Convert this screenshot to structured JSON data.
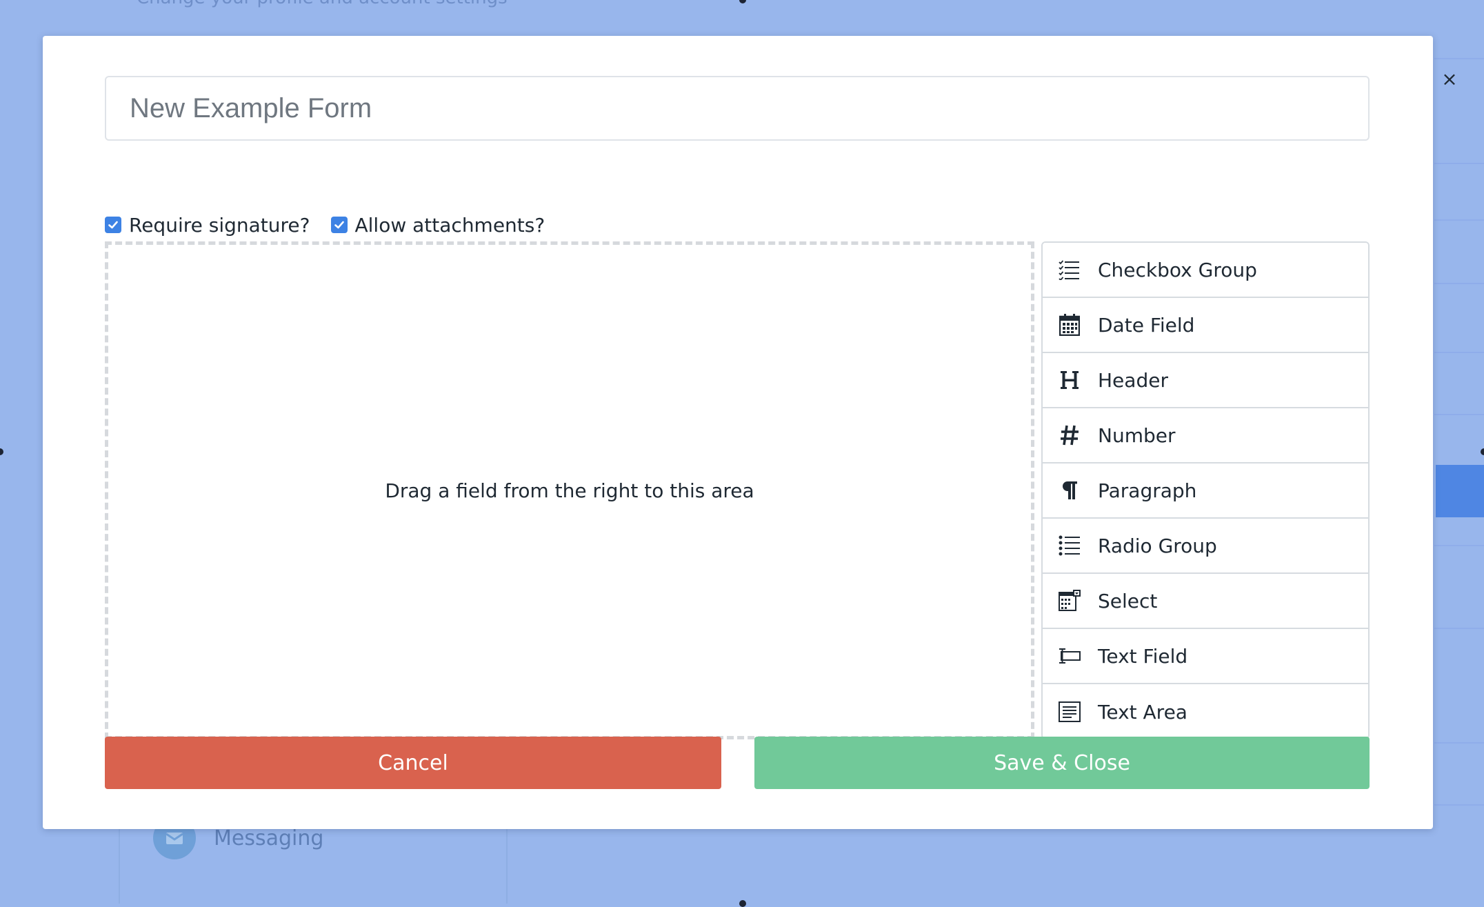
{
  "background": {
    "subtitle": "Change your profile and account settings",
    "sidebar_item_messaging": "Messaging"
  },
  "modal": {
    "form_title_placeholder": "New Example Form",
    "options": [
      {
        "label": "Require signature?",
        "checked": true
      },
      {
        "label": "Allow attachments?",
        "checked": true
      }
    ],
    "drop_area_text": "Drag a field from the right to this area",
    "fields": [
      {
        "label": "Checkbox Group",
        "icon": "checkbox-group-icon"
      },
      {
        "label": "Date Field",
        "icon": "calendar-icon"
      },
      {
        "label": "Header",
        "icon": "header-icon"
      },
      {
        "label": "Number",
        "icon": "hash-icon"
      },
      {
        "label": "Paragraph",
        "icon": "paragraph-icon"
      },
      {
        "label": "Radio Group",
        "icon": "radio-list-icon"
      },
      {
        "label": "Select",
        "icon": "select-icon"
      },
      {
        "label": "Text Field",
        "icon": "text-field-icon"
      },
      {
        "label": "Text Area",
        "icon": "text-area-icon"
      }
    ],
    "cancel_label": "Cancel",
    "save_label": "Save & Close",
    "close_symbol": "×"
  },
  "colors": {
    "backdrop": "#98b6ec",
    "cancel": "#d9624e",
    "save": "#71c999",
    "checkbox": "#3d82e4"
  }
}
